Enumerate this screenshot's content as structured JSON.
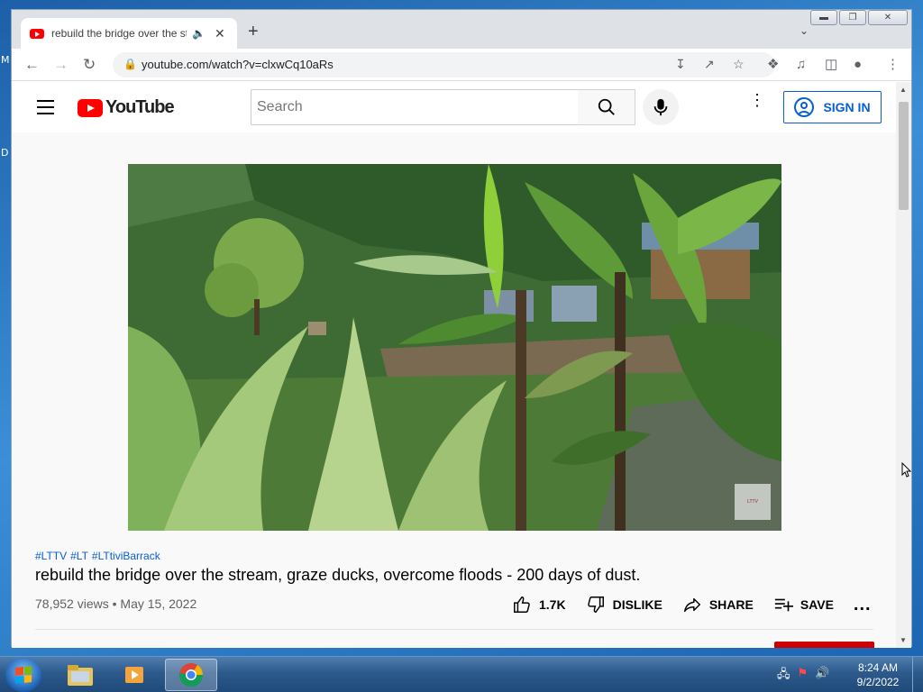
{
  "desktop": {
    "glyph_top": "M",
    "glyph_mid": "D"
  },
  "browser": {
    "tab": {
      "title": "rebuild the bridge over the stream, graze ducks, overcome floods - 200 days of dust. - YouTube"
    },
    "omnibox": {
      "url": "youtube.com/watch?v=clxwCq10aRs"
    }
  },
  "youtube": {
    "logo_text": "YouTube",
    "search_placeholder": "Search",
    "signin_label": "SIGN IN",
    "hashtags": [
      "#LTTV",
      "#LT",
      "#LTtiviBarrack"
    ],
    "video_title": "rebuild the bridge over the stream, graze ducks, overcome floods - 200 days of dust.",
    "views": "78,952 views",
    "date": "May 15, 2022",
    "actions": {
      "like": "1.7K",
      "dislike": "DISLIKE",
      "share": "SHARE",
      "save": "SAVE",
      "more": "..."
    }
  },
  "taskbar": {
    "time": "8:24 AM",
    "date": "9/2/2022"
  },
  "colors": {
    "yt_red": "#ff0000",
    "link_blue": "#065fd4",
    "desktop_blue": "#2a7bc4"
  }
}
